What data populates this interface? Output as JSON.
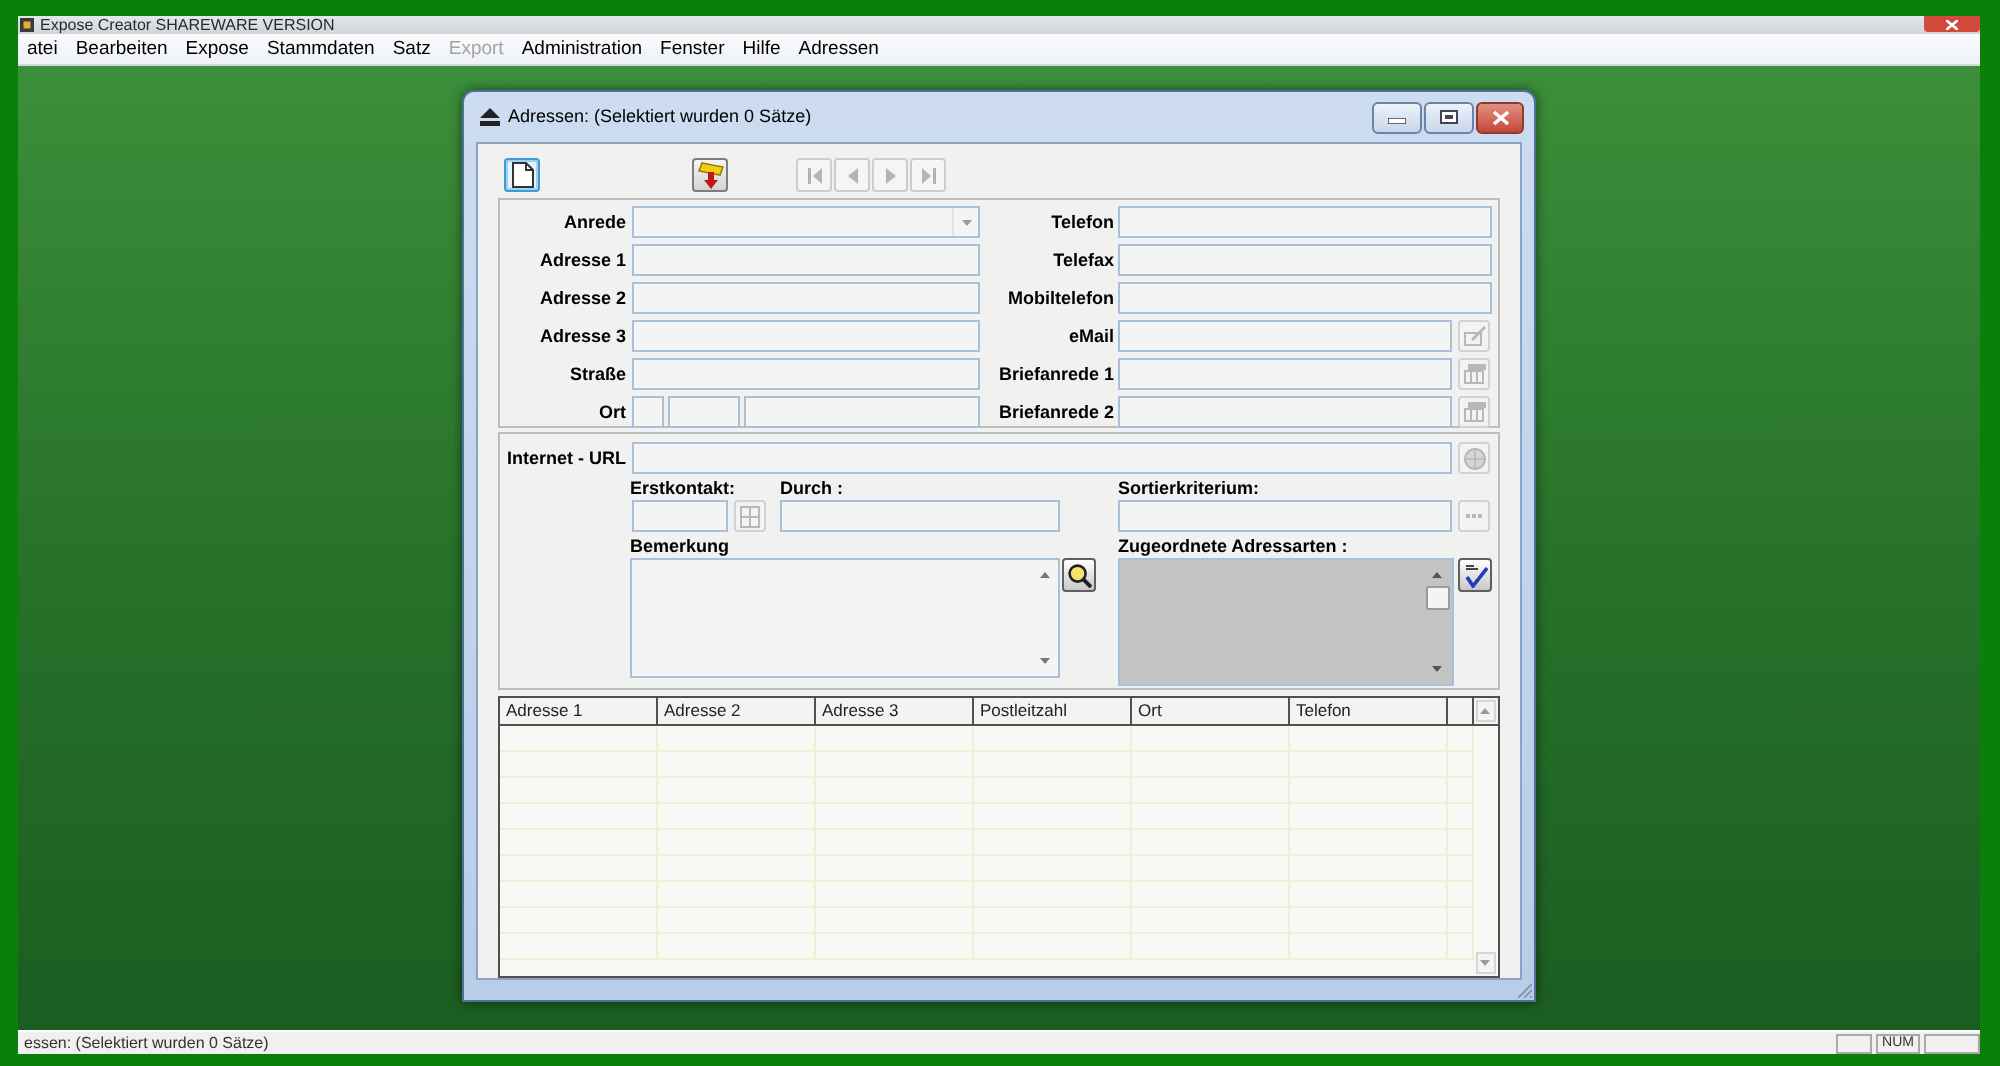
{
  "app_window": {
    "title": "Expose Creator SHAREWARE VERSION"
  },
  "menu": [
    {
      "label": "atei",
      "disabled": false
    },
    {
      "label": "Bearbeiten",
      "disabled": false
    },
    {
      "label": "Expose",
      "disabled": false
    },
    {
      "label": "Stammdaten",
      "disabled": false
    },
    {
      "label": "Satz",
      "disabled": false
    },
    {
      "label": "Export",
      "disabled": true
    },
    {
      "label": "Administration",
      "disabled": false
    },
    {
      "label": "Fenster",
      "disabled": false
    },
    {
      "label": "Hilfe",
      "disabled": false
    },
    {
      "label": "Adressen",
      "disabled": false
    }
  ],
  "dialog": {
    "title": "Adressen: (Selektiert wurden 0 Sätze)",
    "toolbar": [
      {
        "kind": "new",
        "focused": true,
        "disabled": false
      },
      {
        "kind": "tool",
        "focused": false,
        "disabled": false
      },
      {
        "kind": "first",
        "focused": false,
        "disabled": true
      },
      {
        "kind": "previous",
        "focused": false,
        "disabled": true
      },
      {
        "kind": "next",
        "focused": false,
        "disabled": true
      },
      {
        "kind": "last",
        "focused": false,
        "disabled": true
      }
    ],
    "address_fields": [
      {
        "label": "Anrede",
        "kind": "dropdown"
      },
      {
        "label": "Adresse 1",
        "kind": "text"
      },
      {
        "label": "Adresse 2",
        "kind": "text"
      },
      {
        "label": "Adresse 3",
        "kind": "text"
      },
      {
        "label": "Straße",
        "kind": "text"
      },
      {
        "label": "Ort",
        "kind": "split"
      }
    ],
    "contact_fields": [
      {
        "label": "Telefon",
        "kind": "text"
      },
      {
        "label": "Telefax",
        "kind": "text"
      },
      {
        "label": "Mobiltelefon",
        "kind": "text"
      },
      {
        "label": "eMail",
        "kind": "edit_button",
        "button_disabled": true
      },
      {
        "label": "Briefanrede 1",
        "kind": "card_button",
        "button_disabled": true
      },
      {
        "label": "Briefanrede 2",
        "kind": "card_button",
        "button_disabled": true
      }
    ],
    "internet_url": {
      "label": "Internet - URL",
      "button_disabled": true
    },
    "erstkontakt": {
      "label": "Erstkontakt:",
      "button_disabled": true
    },
    "durch": {
      "label": "Durch :"
    },
    "sortierkriterium": {
      "label": "Sortierkriterium:",
      "button_disabled": true
    },
    "bemerkung": {
      "label": "Bemerkung",
      "button_disabled": false
    },
    "adressarten": {
      "label": "Zugeordnete Adressarten :",
      "button_disabled": false
    },
    "table": {
      "columns": [
        "Adresse 1",
        "Adresse 2",
        "Adresse 3",
        "Postleitzahl",
        "Ort",
        "Telefon"
      ]
    }
  },
  "status_bar": {
    "text": "essen: (Selektiert wurden 0 Sätze)",
    "indicators": [
      "NUM"
    ]
  }
}
